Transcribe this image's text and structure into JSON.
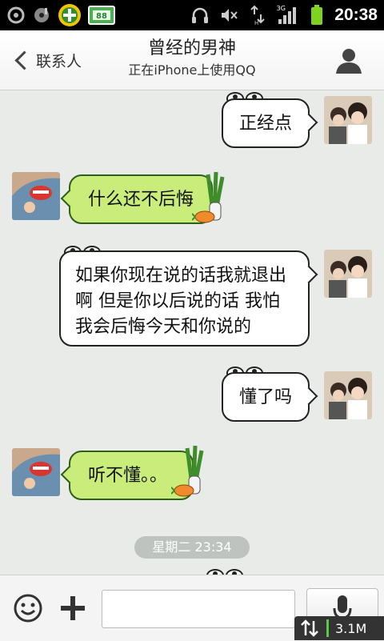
{
  "status_bar": {
    "time": "20:38",
    "network_type": "3G",
    "left_icons": [
      "settings-notification-icon",
      "media-notification-icon",
      "security-app-icon",
      "calendar-app-icon"
    ],
    "right_icons": [
      "headset-icon",
      "mute-icon",
      "data-transfer-icon",
      "signal-icon",
      "battery-icon"
    ]
  },
  "header": {
    "back_label": "联系人",
    "title": "曾经的男神",
    "subtitle": "正在iPhone上使用QQ"
  },
  "messages": [
    {
      "side": "right",
      "style": "white",
      "text": "正经点"
    },
    {
      "side": "left",
      "style": "green",
      "text": "什么还不后悔"
    },
    {
      "side": "right",
      "style": "white",
      "text": "如果你现在说的话我就退出啊 但是你以后说的话 我怕我会后悔今天和你说的"
    },
    {
      "side": "right",
      "style": "white",
      "text": "懂了吗"
    },
    {
      "side": "left",
      "style": "green",
      "text": "听不懂。。"
    }
  ],
  "timestamp": "星期二 23:34",
  "input": {
    "value": "",
    "placeholder": ""
  },
  "net_indicator": {
    "speed": "3.1M"
  },
  "colors": {
    "chat_background": "#e9ebe8",
    "bubble_green": "#c9ec7a",
    "bubble_white": "#ffffff",
    "status_bar": "#000000",
    "battery": "#7ed321"
  }
}
